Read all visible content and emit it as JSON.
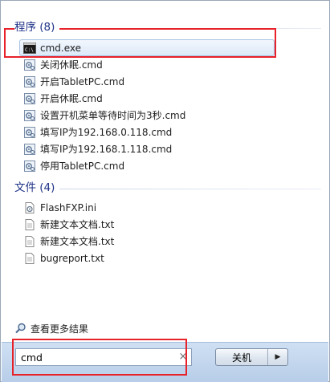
{
  "programs": {
    "header": "程序 (8)",
    "items": [
      {
        "label": "cmd.exe",
        "icon": "cmd-icon",
        "selected": true
      },
      {
        "label": "关闭休眠.cmd",
        "icon": "script-icon"
      },
      {
        "label": "开启TabletPC.cmd",
        "icon": "script-icon"
      },
      {
        "label": "开启休眠.cmd",
        "icon": "script-icon"
      },
      {
        "label": "设置开机菜单等待时间为3秒.cmd",
        "icon": "script-icon"
      },
      {
        "label": "填写IP为192.168.0.118.cmd",
        "icon": "script-icon"
      },
      {
        "label": "填写IP为192.168.1.118.cmd",
        "icon": "script-icon"
      },
      {
        "label": "停用TabletPC.cmd",
        "icon": "script-icon"
      }
    ]
  },
  "files": {
    "header": "文件 (4)",
    "items": [
      {
        "label": "FlashFXP.ini",
        "icon": "ini-file-icon"
      },
      {
        "label": "新建文本文档.txt",
        "icon": "text-file-icon"
      },
      {
        "label": "新建文本文档.txt",
        "icon": "text-file-icon"
      },
      {
        "label": "bugreport.txt",
        "icon": "text-file-icon"
      }
    ]
  },
  "more_results": {
    "label": "查看更多结果",
    "icon": "search-icon"
  },
  "search": {
    "value": "cmd",
    "clear_icon": "×"
  },
  "shutdown": {
    "label": "关机",
    "arrow": "▶"
  },
  "colors": {
    "header_text": "#1e3287",
    "highlight_border": "#e8222a",
    "selection_fill": "#dce9f8",
    "bottom_bar": "#c3d6ee"
  }
}
